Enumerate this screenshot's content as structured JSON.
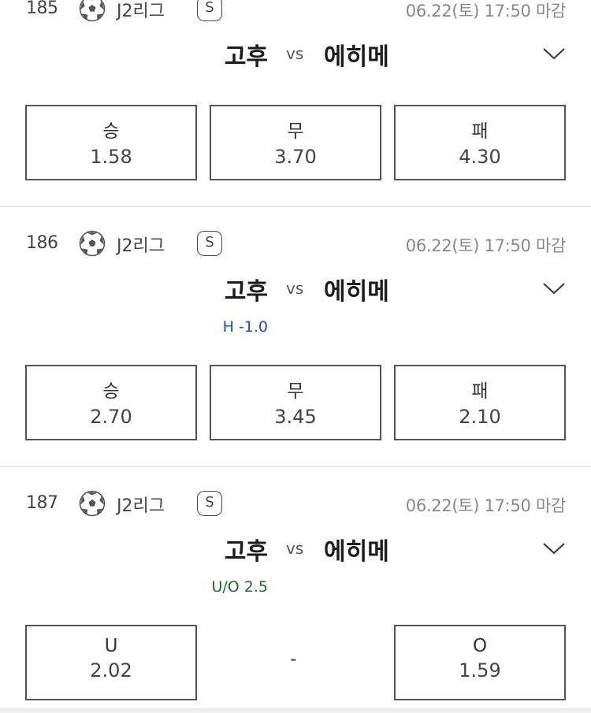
{
  "matches": [
    {
      "number": "185",
      "league": "J2리그",
      "badge": "S",
      "deadline": "06.22(토) 17:50 마감",
      "home": "고후",
      "vs": "vs",
      "away": "에히메",
      "handicap": "",
      "odds": [
        {
          "label": "승",
          "value": "1.58"
        },
        {
          "label": "무",
          "value": "3.70"
        },
        {
          "label": "패",
          "value": "4.30"
        }
      ]
    },
    {
      "number": "186",
      "league": "J2리그",
      "badge": "S",
      "deadline": "06.22(토) 17:50 마감",
      "home": "고후",
      "vs": "vs",
      "away": "에히메",
      "handicap": "H -1.0",
      "handicap_color": "#1f4fb5",
      "odds": [
        {
          "label": "승",
          "value": "2.70"
        },
        {
          "label": "무",
          "value": "3.45"
        },
        {
          "label": "패",
          "value": "2.10"
        }
      ]
    },
    {
      "number": "187",
      "league": "J2리그",
      "badge": "S",
      "deadline": "06.22(토) 17:50 마감",
      "home": "고후",
      "vs": "vs",
      "away": "에히메",
      "handicap": "U/O 2.5",
      "handicap_color": "#1d6b2a",
      "odds": [
        {
          "label": "U",
          "value": "2.02"
        },
        {
          "label": "O",
          "value": "1.59"
        }
      ],
      "middle_placeholder": "-"
    }
  ],
  "icons": {
    "sport": "soccer-ball-icon",
    "expand": "chevron-down-icon"
  }
}
